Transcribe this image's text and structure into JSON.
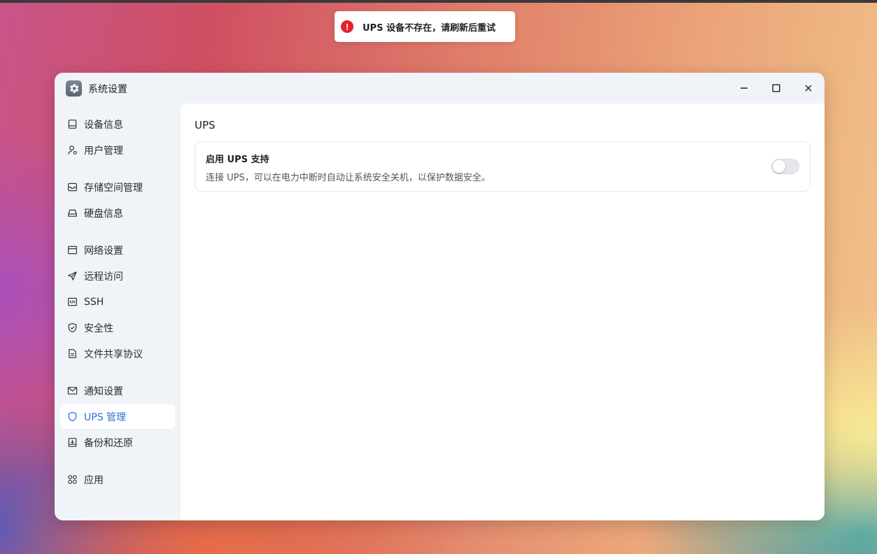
{
  "toast": {
    "icon": "error-icon",
    "message": "UPS 设备不存在，请刷新后重试",
    "color": "#e8202a"
  },
  "window": {
    "title": "系统设置",
    "icon": "gear-icon",
    "controls": [
      "minimize-icon",
      "maximize-icon",
      "close-icon"
    ]
  },
  "sidebar": {
    "items": [
      {
        "label": "设备信息",
        "icon": "device-icon"
      },
      {
        "label": "用户管理",
        "icon": "user-icon"
      },
      {
        "label": "存储空间管理",
        "icon": "storage-icon"
      },
      {
        "label": "硬盘信息",
        "icon": "disk-icon"
      },
      {
        "label": "网络设置",
        "icon": "network-icon"
      },
      {
        "label": "远程访问",
        "icon": "send-icon"
      },
      {
        "label": "SSH",
        "icon": "code-icon"
      },
      {
        "label": "安全性",
        "icon": "shield-check-icon"
      },
      {
        "label": "文件共享协议",
        "icon": "file-icon"
      },
      {
        "label": "通知设置",
        "icon": "mail-icon"
      },
      {
        "label": "UPS 管理",
        "icon": "shield-icon",
        "active": true
      },
      {
        "label": "备份和还原",
        "icon": "backup-icon"
      },
      {
        "label": "应用",
        "icon": "apps-icon"
      }
    ],
    "accent": "#2f6fd6"
  },
  "main": {
    "section_title": "UPS",
    "card": {
      "title": "启用 UPS 支持",
      "description": "连接 UPS，可以在电力中断时自动让系统安全关机，以保护数据安全。",
      "toggle_on": false
    }
  }
}
